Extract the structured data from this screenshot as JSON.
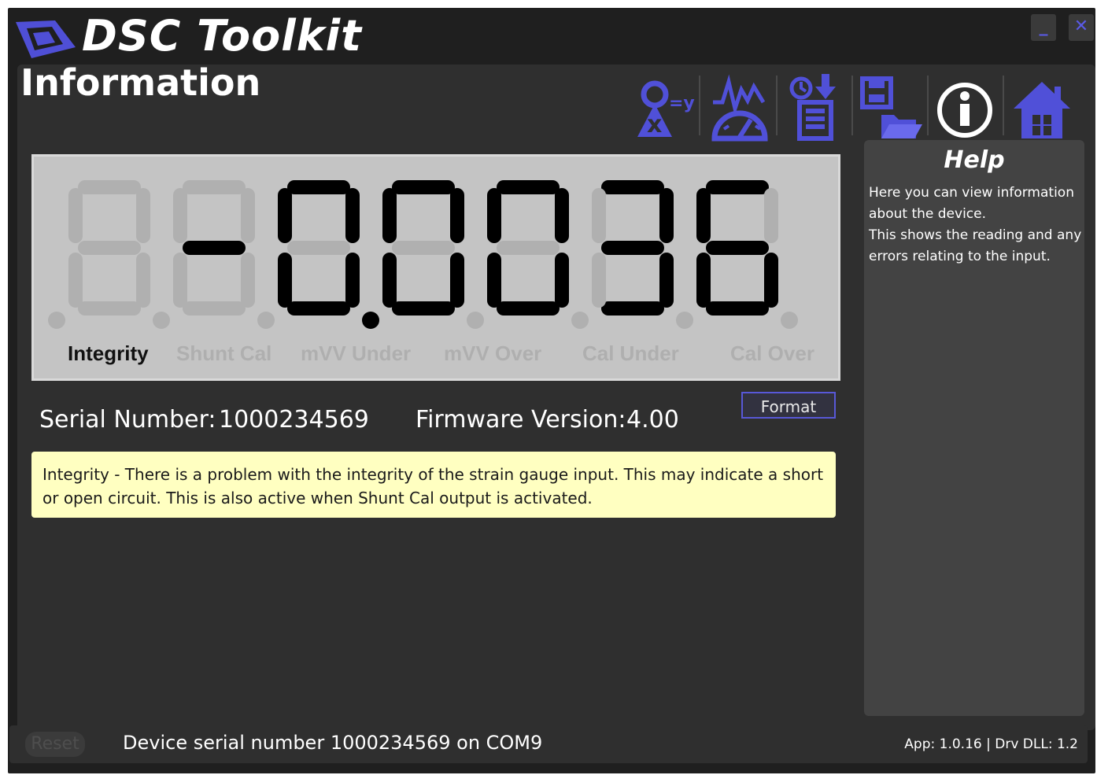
{
  "app": {
    "title": "DSC Toolkit",
    "minimize_icon": "minimize-icon",
    "close_icon": "close-icon"
  },
  "page": {
    "title": "Information"
  },
  "toolbar": {
    "items": [
      "scaling-icon",
      "gauge-chart-icon",
      "datalog-icon",
      "save-load-icon",
      "info-icon",
      "home-icon"
    ],
    "accent_color": "#5050d8"
  },
  "display": {
    "reading": "-0.0036",
    "digit_on_color": "#000000",
    "digit_off_color": "#b0b0b0",
    "background_color": "#c4c4c4",
    "flags": [
      {
        "label": "Integrity",
        "active": true
      },
      {
        "label": "Shunt Cal",
        "active": false
      },
      {
        "label": "mVV Under",
        "active": false
      },
      {
        "label": "mVV Over",
        "active": false
      },
      {
        "label": "Cal Under",
        "active": false
      },
      {
        "label": "Cal Over",
        "active": false
      }
    ]
  },
  "device": {
    "serial_label": "Serial Number:",
    "serial_value": "1000234569",
    "firmware_label": "Firmware Version:",
    "firmware_value": "4.00"
  },
  "format_button": "Format",
  "alert": {
    "text": "Integrity - There is a problem with the integrity of the strain gauge input. This may indicate a short or open circuit. This is also active when Shunt Cal output is activated.",
    "color": "#ffffc1"
  },
  "help": {
    "title": "Help",
    "line1": "Here you can view information about the device.",
    "line2": "This shows the reading and any errors relating to the input."
  },
  "statusbar": {
    "reset_label": "Reset",
    "status": "Device serial number 1000234569 on COM9",
    "version": "App: 1.0.16 | Drv DLL: 1.2"
  }
}
